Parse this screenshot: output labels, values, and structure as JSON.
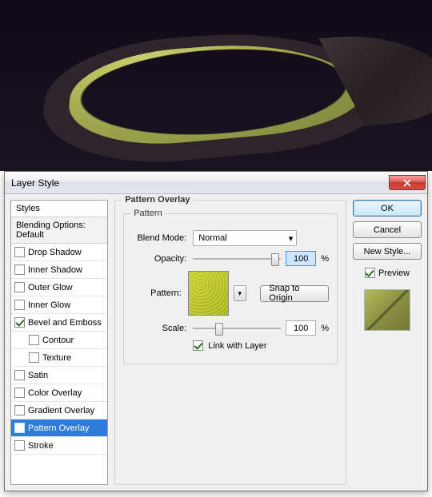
{
  "dialog": {
    "title": "Layer Style",
    "group_title": "Pattern Overlay",
    "subgroup_title": "Pattern",
    "labels": {
      "blend_mode": "Blend Mode:",
      "opacity": "Opacity:",
      "pattern": "Pattern:",
      "scale": "Scale:",
      "percent": "%"
    },
    "blend_mode_value": "Normal",
    "opacity_value": "100",
    "scale_value": "100",
    "snap_to_origin": "Snap to Origin",
    "link_with_layer": "Link with Layer"
  },
  "styles": {
    "header": "Styles",
    "subheader": "Blending Options: Default",
    "items": [
      {
        "label": "Drop Shadow",
        "checked": false
      },
      {
        "label": "Inner Shadow",
        "checked": false
      },
      {
        "label": "Outer Glow",
        "checked": false
      },
      {
        "label": "Inner Glow",
        "checked": false
      },
      {
        "label": "Bevel and Emboss",
        "checked": true
      },
      {
        "label": "Contour",
        "checked": false,
        "indented": true
      },
      {
        "label": "Texture",
        "checked": false,
        "indented": true
      },
      {
        "label": "Satin",
        "checked": false
      },
      {
        "label": "Color Overlay",
        "checked": false
      },
      {
        "label": "Gradient Overlay",
        "checked": false
      },
      {
        "label": "Pattern Overlay",
        "checked": true,
        "selected": true
      },
      {
        "label": "Stroke",
        "checked": false
      }
    ]
  },
  "buttons": {
    "ok": "OK",
    "cancel": "Cancel",
    "new_style": "New Style...",
    "preview": "Preview"
  }
}
